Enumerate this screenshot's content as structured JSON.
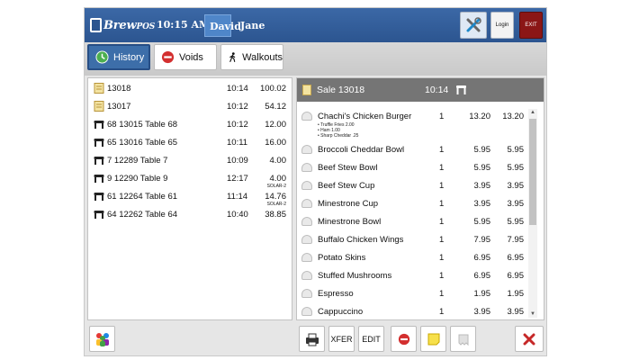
{
  "app": {
    "name_main": "Brew",
    "name_suffix": "POS"
  },
  "header": {
    "time": "10:15 AM",
    "users": [
      "David",
      "Jane"
    ],
    "login_label": "Login",
    "exit_label": "EXIT"
  },
  "tabs": [
    {
      "label": "History",
      "icon": "history-icon"
    },
    {
      "label": "Voids",
      "icon": "no-entry-icon"
    },
    {
      "label": "Walkouts",
      "icon": "walking-person-icon"
    }
  ],
  "history": [
    {
      "icon": "notepad-icon",
      "label": "13018",
      "time": "10:14",
      "amount": "100.02",
      "sub": ""
    },
    {
      "icon": "notepad-icon",
      "label": "13017",
      "time": "10:12",
      "amount": "54.12",
      "sub": ""
    },
    {
      "icon": "table-icon",
      "label": "68  13015   Table 68",
      "time": "10:12",
      "amount": "12.00",
      "sub": ""
    },
    {
      "icon": "table-icon",
      "label": "65  13016   Table 65",
      "time": "10:11",
      "amount": "16.00",
      "sub": ""
    },
    {
      "icon": "table-icon",
      "label": "7   12289   Table 7",
      "time": "10:09",
      "amount": "4.00",
      "sub": ""
    },
    {
      "icon": "table-icon",
      "label": "9   12290   Table 9",
      "time": "12:17",
      "amount": "4.00",
      "sub": "SOLAR-2"
    },
    {
      "icon": "table-icon",
      "label": "61  12264   Table 61",
      "time": "11:14",
      "amount": "14.76",
      "sub": "SOLAR-2"
    },
    {
      "icon": "table-icon",
      "label": "64  12262   Table 64",
      "time": "10:40",
      "amount": "38.85",
      "sub": ""
    }
  ],
  "receipt": {
    "title": "Sale 13018",
    "time": "10:14",
    "items": [
      {
        "name": "Chachi's Chicken Burger",
        "qty": "1",
        "price": "13.20",
        "total": "13.20",
        "modifiers": [
          "• Truffle Fries 2.00",
          "• Ham 1.00",
          "• Sharp Cheddar .25"
        ]
      },
      {
        "name": "Broccoli Cheddar Bowl",
        "qty": "1",
        "price": "5.95",
        "total": "5.95",
        "modifiers": []
      },
      {
        "name": "Beef Stew Bowl",
        "qty": "1",
        "price": "5.95",
        "total": "5.95",
        "modifiers": []
      },
      {
        "name": "Beef Stew Cup",
        "qty": "1",
        "price": "3.95",
        "total": "3.95",
        "modifiers": []
      },
      {
        "name": "Minestrone Cup",
        "qty": "1",
        "price": "3.95",
        "total": "3.95",
        "modifiers": []
      },
      {
        "name": "Minestrone Bowl",
        "qty": "1",
        "price": "5.95",
        "total": "5.95",
        "modifiers": []
      },
      {
        "name": "Buffalo Chicken Wings",
        "qty": "1",
        "price": "7.95",
        "total": "7.95",
        "modifiers": []
      },
      {
        "name": "Potato Skins",
        "qty": "1",
        "price": "6.95",
        "total": "6.95",
        "modifiers": []
      },
      {
        "name": "Stuffed Mushrooms",
        "qty": "1",
        "price": "6.95",
        "total": "6.95",
        "modifiers": []
      },
      {
        "name": "Espresso",
        "qty": "1",
        "price": "1.95",
        "total": "1.95",
        "modifiers": []
      },
      {
        "name": "Cappuccino",
        "qty": "1",
        "price": "3.95",
        "total": "3.95",
        "modifiers": []
      }
    ]
  },
  "bottom": {
    "xfer_label": "XFER",
    "edit_label": "EDIT"
  },
  "colors": {
    "header_blue": "#2c5590",
    "active_tab": "#3d6ea9",
    "exit_red": "#8b1616",
    "close_red": "#c62828"
  }
}
